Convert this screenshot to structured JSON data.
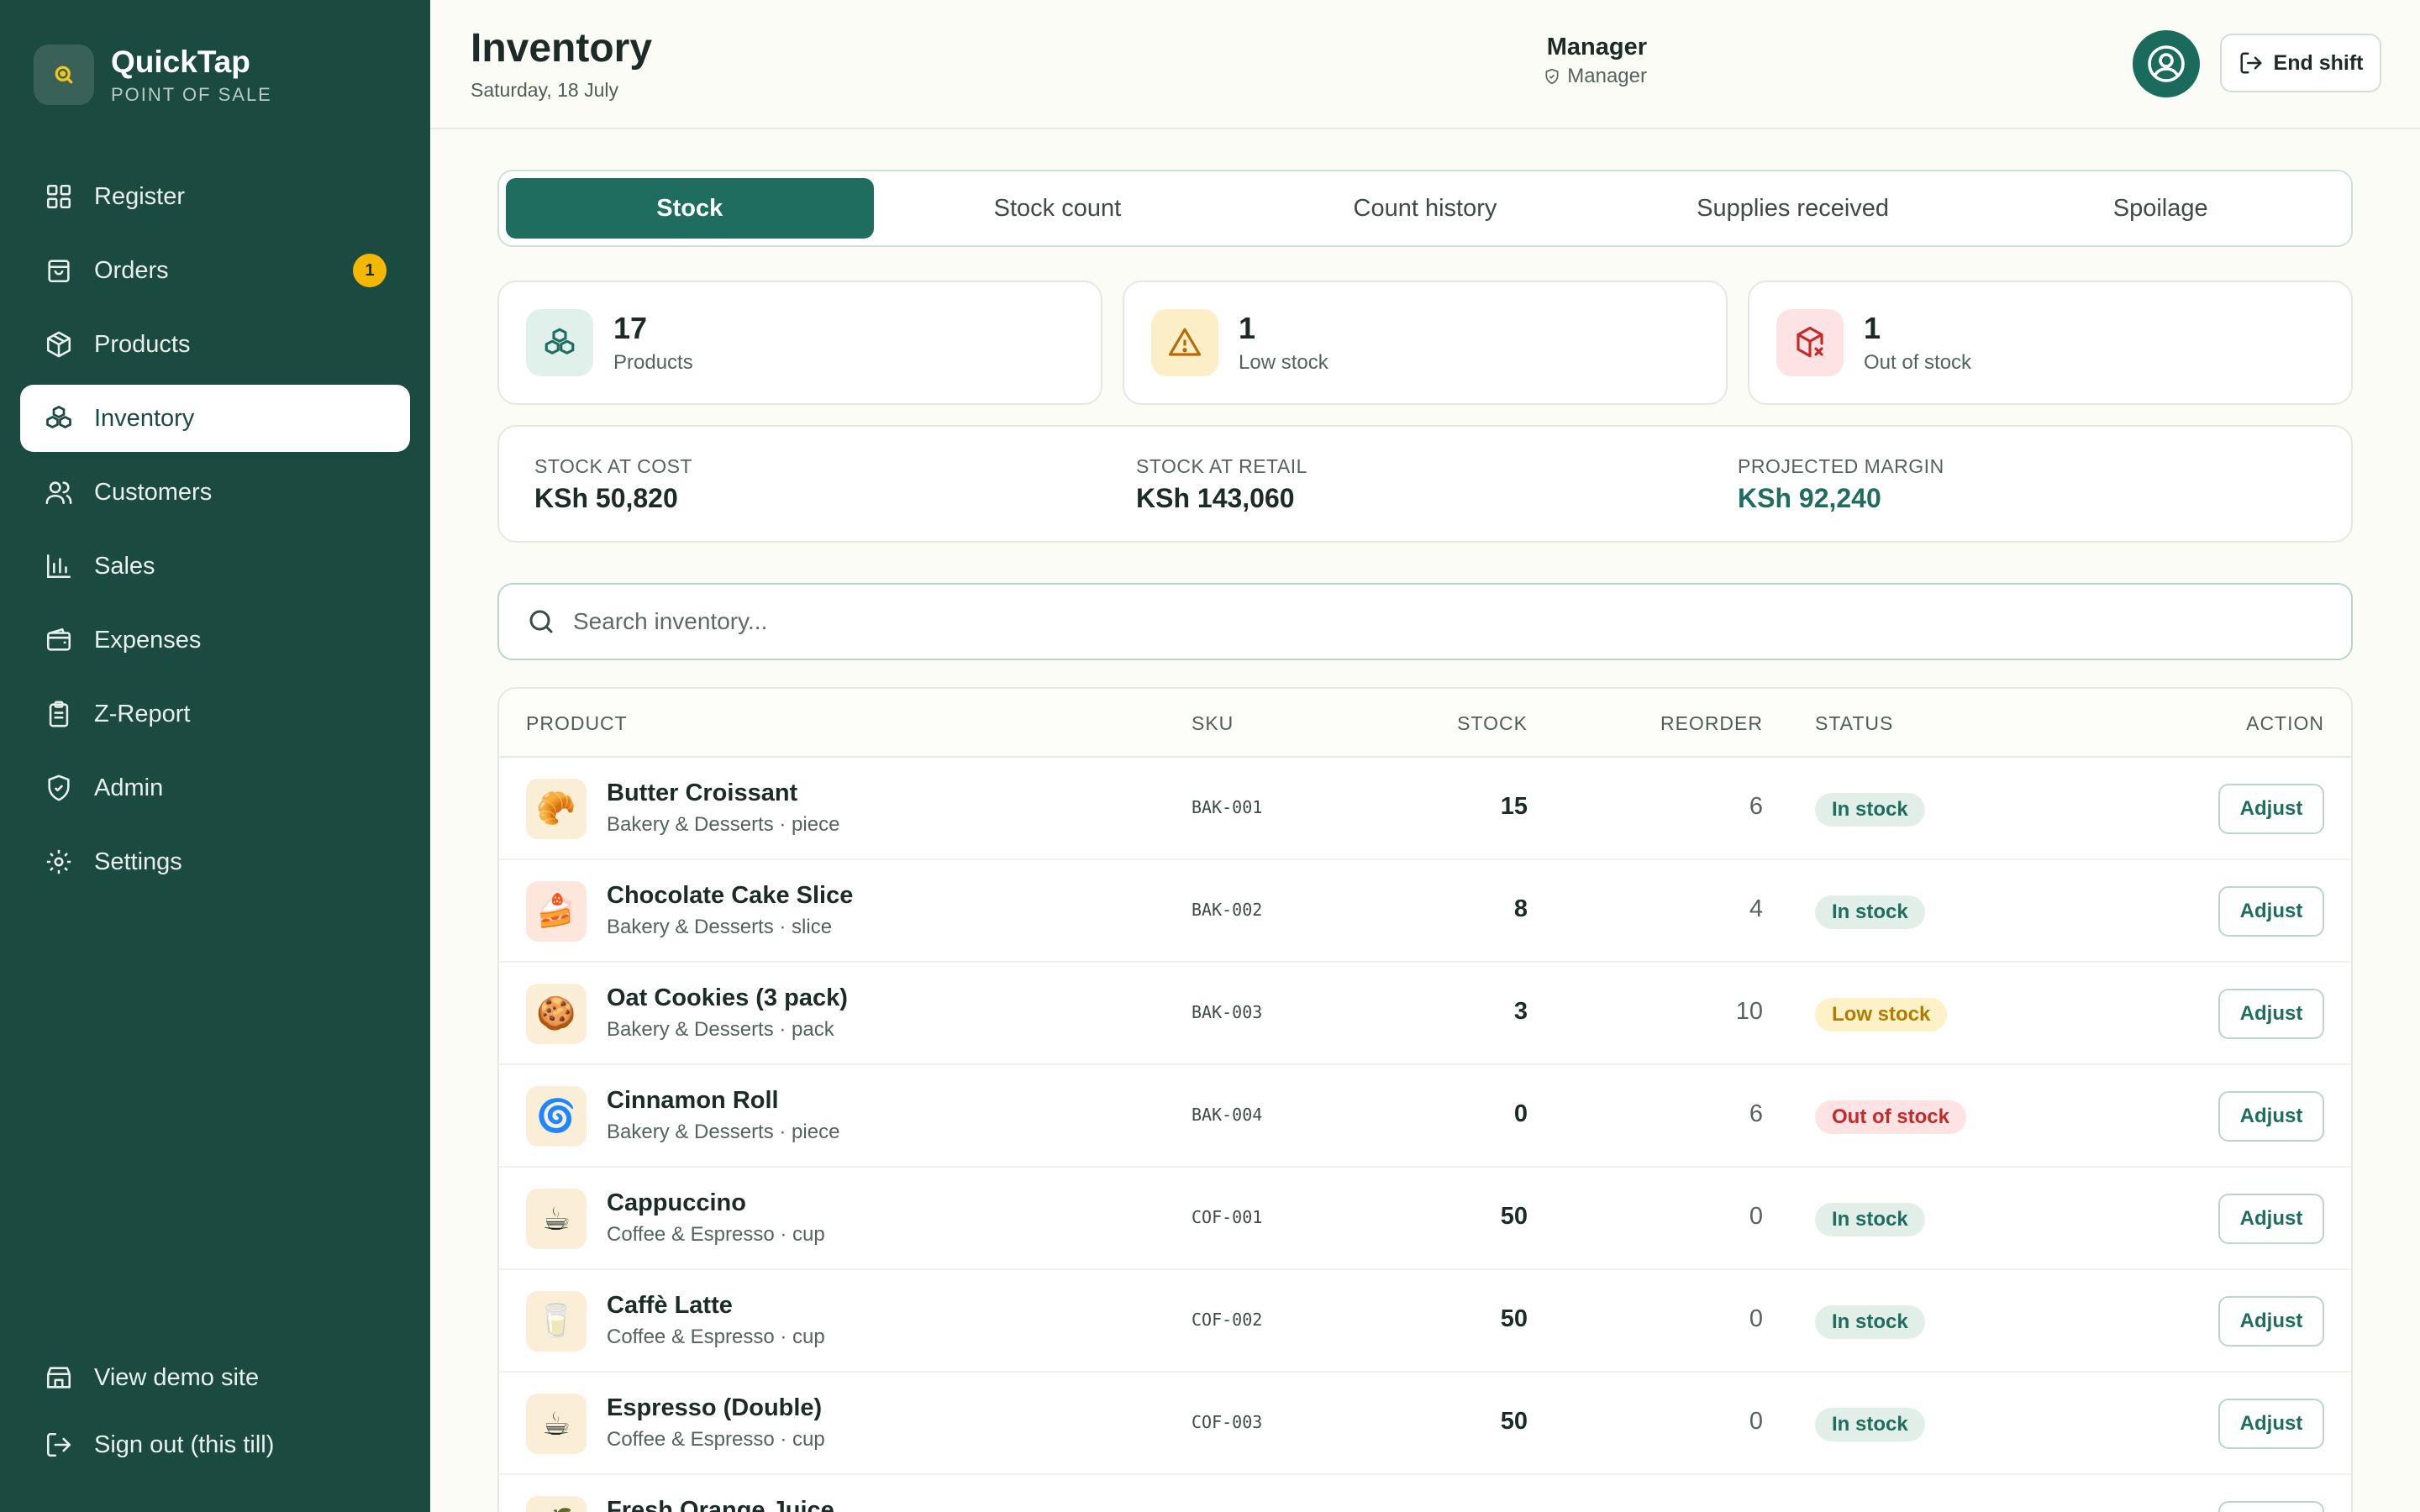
{
  "brand": {
    "name": "QuickTap",
    "subtitle": "POINT OF SALE"
  },
  "sidebar": {
    "items": [
      {
        "label": "Register",
        "icon": "grid-icon"
      },
      {
        "label": "Orders",
        "icon": "bag-icon",
        "badge": "1"
      },
      {
        "label": "Products",
        "icon": "box-icon"
      },
      {
        "label": "Inventory",
        "icon": "boxes-icon",
        "active": true
      },
      {
        "label": "Customers",
        "icon": "users-icon"
      },
      {
        "label": "Sales",
        "icon": "bar-chart-icon"
      },
      {
        "label": "Expenses",
        "icon": "wallet-icon"
      },
      {
        "label": "Z-Report",
        "icon": "clipboard-icon"
      },
      {
        "label": "Admin",
        "icon": "shield-icon"
      },
      {
        "label": "Settings",
        "icon": "gear-icon"
      }
    ],
    "bottom": [
      {
        "label": "View demo site",
        "icon": "store-icon"
      },
      {
        "label": "Sign out (this till)",
        "icon": "logout-icon"
      }
    ]
  },
  "header": {
    "title": "Inventory",
    "date": "Saturday, 18 July",
    "user_name": "Manager",
    "user_role": "Manager",
    "end_shift": "End shift"
  },
  "tabs": [
    {
      "label": "Stock",
      "active": true
    },
    {
      "label": "Stock count"
    },
    {
      "label": "Count history"
    },
    {
      "label": "Supplies received"
    },
    {
      "label": "Spoilage"
    }
  ],
  "stats": [
    {
      "value": "17",
      "label": "Products",
      "icon": "boxes-icon"
    },
    {
      "value": "1",
      "label": "Low stock",
      "icon": "warning-icon"
    },
    {
      "value": "1",
      "label": "Out of stock",
      "icon": "box-x-icon"
    }
  ],
  "summary": {
    "cost_label": "STOCK AT COST",
    "cost_value": "KSh 50,820",
    "retail_label": "STOCK AT RETAIL",
    "retail_value": "KSh 143,060",
    "margin_label": "PROJECTED MARGIN",
    "margin_value": "KSh 92,240"
  },
  "search": {
    "placeholder": "Search inventory..."
  },
  "table": {
    "headers": {
      "product": "PRODUCT",
      "sku": "SKU",
      "stock": "STOCK",
      "reorder": "REORDER",
      "status": "STATUS",
      "action": "ACTION"
    },
    "action_label": "Adjust",
    "rows": [
      {
        "name": "Butter Croissant",
        "sub": "Bakery & Desserts · piece",
        "sku": "BAK-001",
        "stock": "15",
        "reorder": "6",
        "status": "In stock",
        "status_type": "in",
        "emoji": "🥐",
        "thumb_bg": "#fbeed6"
      },
      {
        "name": "Chocolate Cake Slice",
        "sub": "Bakery & Desserts · slice",
        "sku": "BAK-002",
        "stock": "8",
        "reorder": "4",
        "status": "In stock",
        "status_type": "in",
        "emoji": "🍰",
        "thumb_bg": "#fde6dc"
      },
      {
        "name": "Oat Cookies (3 pack)",
        "sub": "Bakery & Desserts · pack",
        "sku": "BAK-003",
        "stock": "3",
        "reorder": "10",
        "status": "Low stock",
        "status_type": "low",
        "emoji": "🍪",
        "thumb_bg": "#fbeed6"
      },
      {
        "name": "Cinnamon Roll",
        "sub": "Bakery & Desserts · piece",
        "sku": "BAK-004",
        "stock": "0",
        "reorder": "6",
        "status": "Out of stock",
        "status_type": "out",
        "emoji": "🌀",
        "thumb_bg": "#fbeed6"
      },
      {
        "name": "Cappuccino",
        "sub": "Coffee & Espresso · cup",
        "sku": "COF-001",
        "stock": "50",
        "reorder": "0",
        "status": "In stock",
        "status_type": "in",
        "emoji": "☕",
        "thumb_bg": "#fbeed6"
      },
      {
        "name": "Caffè Latte",
        "sub": "Coffee & Espresso · cup",
        "sku": "COF-002",
        "stock": "50",
        "reorder": "0",
        "status": "In stock",
        "status_type": "in",
        "emoji": "🥛",
        "thumb_bg": "#fbeed6"
      },
      {
        "name": "Espresso (Double)",
        "sub": "Coffee & Espresso · cup",
        "sku": "COF-003",
        "stock": "50",
        "reorder": "0",
        "status": "In stock",
        "status_type": "in",
        "emoji": "☕",
        "thumb_bg": "#fbeed6"
      },
      {
        "name": "Fresh Orange Juice",
        "sub": "",
        "sku": "",
        "stock": "",
        "reorder": "",
        "status": "",
        "status_type": "in",
        "emoji": "🍊",
        "thumb_bg": "#fbeed6"
      }
    ]
  },
  "colors": {
    "sidebar": "#1b4a40",
    "accent": "#1f6d5e",
    "badge": "#f5b800"
  }
}
